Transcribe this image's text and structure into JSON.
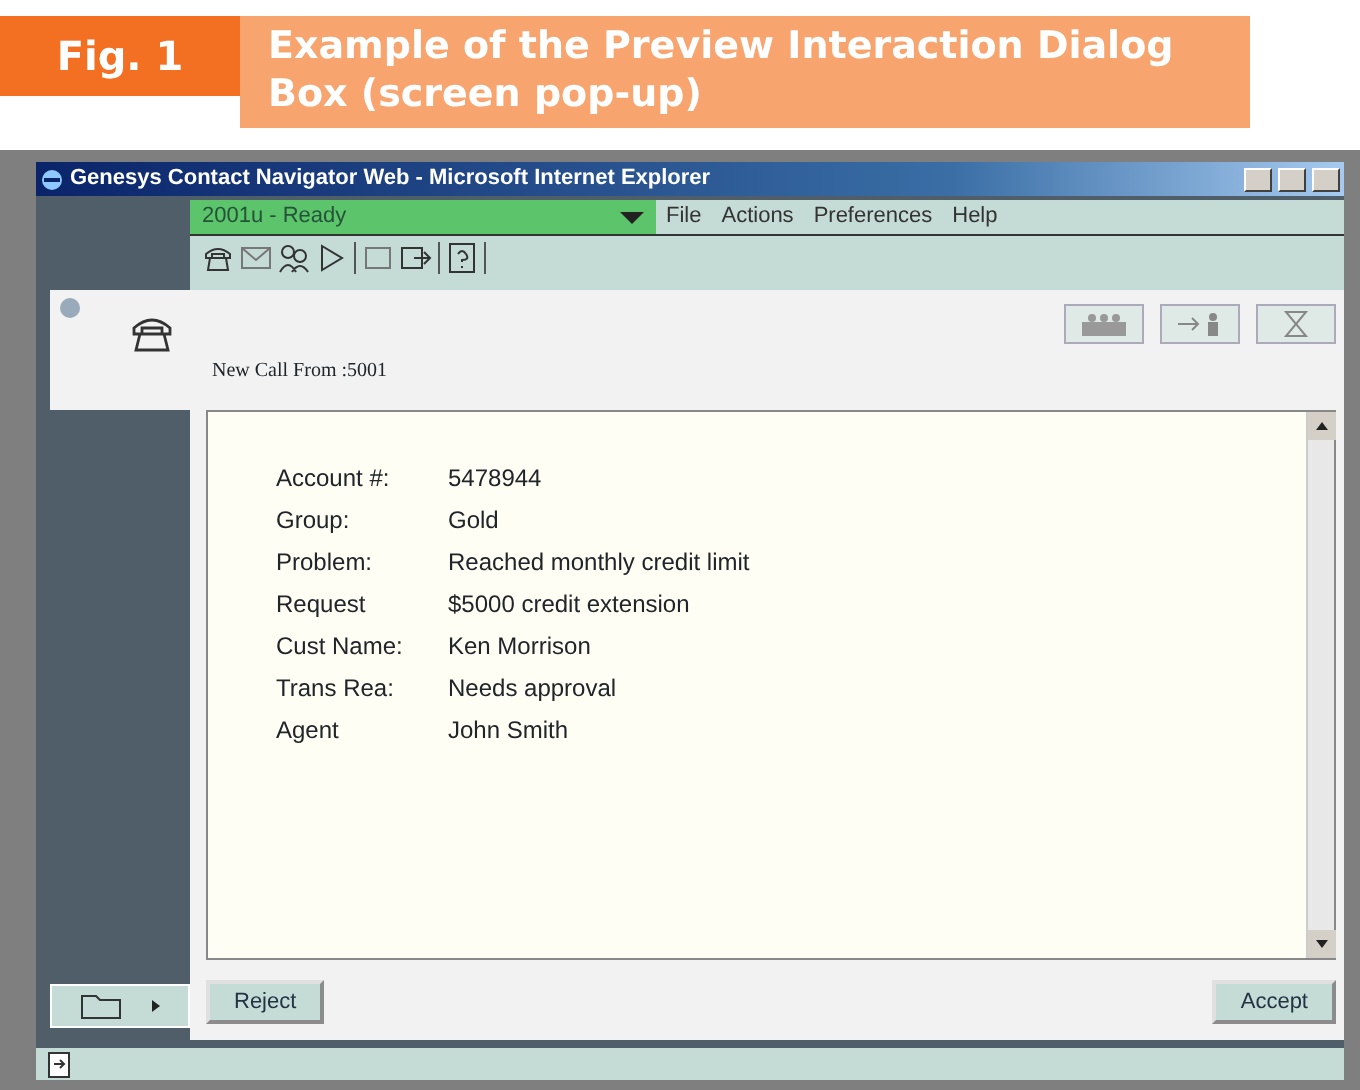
{
  "caption": {
    "label": "Fig. 1",
    "title": "Example of the Preview Interaction Dialog Box (screen pop-up)"
  },
  "window": {
    "title": "Genesys Contact Navigator Web - Microsoft Internet Explorer"
  },
  "status_dropdown": {
    "value": "2001u - Ready"
  },
  "menu": [
    "File",
    "Actions",
    "Preferences",
    "Help"
  ],
  "call_header": {
    "text": "New Call From :5001"
  },
  "fields": [
    {
      "label": "Account #:",
      "value": "5478944"
    },
    {
      "label": "Group:",
      "value": "Gold"
    },
    {
      "label": "Problem:",
      "value": "Reached monthly credit limit"
    },
    {
      "label": "Request",
      "value": "$5000 credit extension"
    },
    {
      "label": "Cust Name:",
      "value": "Ken Morrison"
    },
    {
      "label": "Trans Rea:",
      "value": "Needs approval"
    },
    {
      "label": "Agent",
      "value": "John Smith"
    }
  ],
  "buttons": [
    "Reject",
    "Accept"
  ]
}
